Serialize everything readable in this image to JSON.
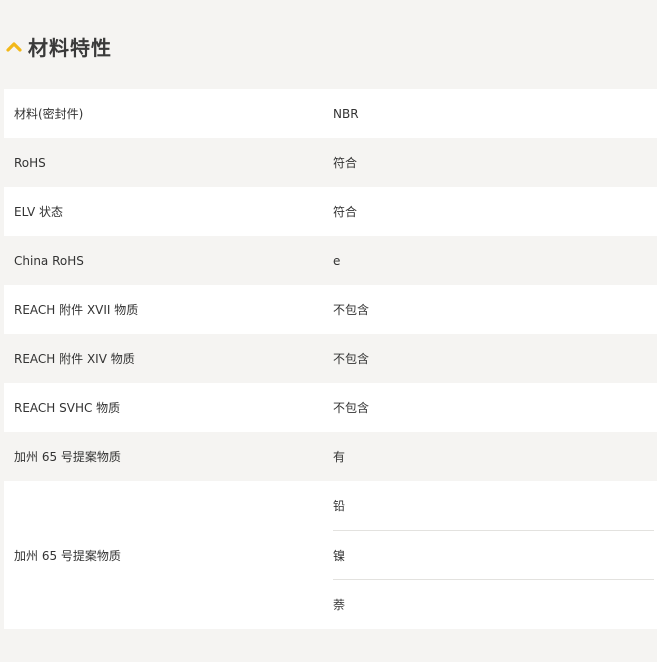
{
  "section": {
    "title": "材料特性",
    "icon": "chevron-up-icon",
    "accent_color": "#f2b81a"
  },
  "rows": [
    {
      "label": "材料(密封件)",
      "value": "NBR"
    },
    {
      "label": "RoHS",
      "value": "符合"
    },
    {
      "label": "ELV 状态",
      "value": "符合"
    },
    {
      "label": "China RoHS",
      "value": "e"
    },
    {
      "label": "REACH 附件 XVII 物质",
      "value": "不包含"
    },
    {
      "label": "REACH 附件 XIV 物质",
      "value": "不包含"
    },
    {
      "label": "REACH SVHC 物质",
      "value": "不包含"
    },
    {
      "label": "加州 65 号提案物质",
      "value": "有"
    }
  ],
  "multi_row": {
    "label": "加州 65 号提案物质",
    "values": [
      "铅",
      "镍",
      "萘"
    ]
  }
}
